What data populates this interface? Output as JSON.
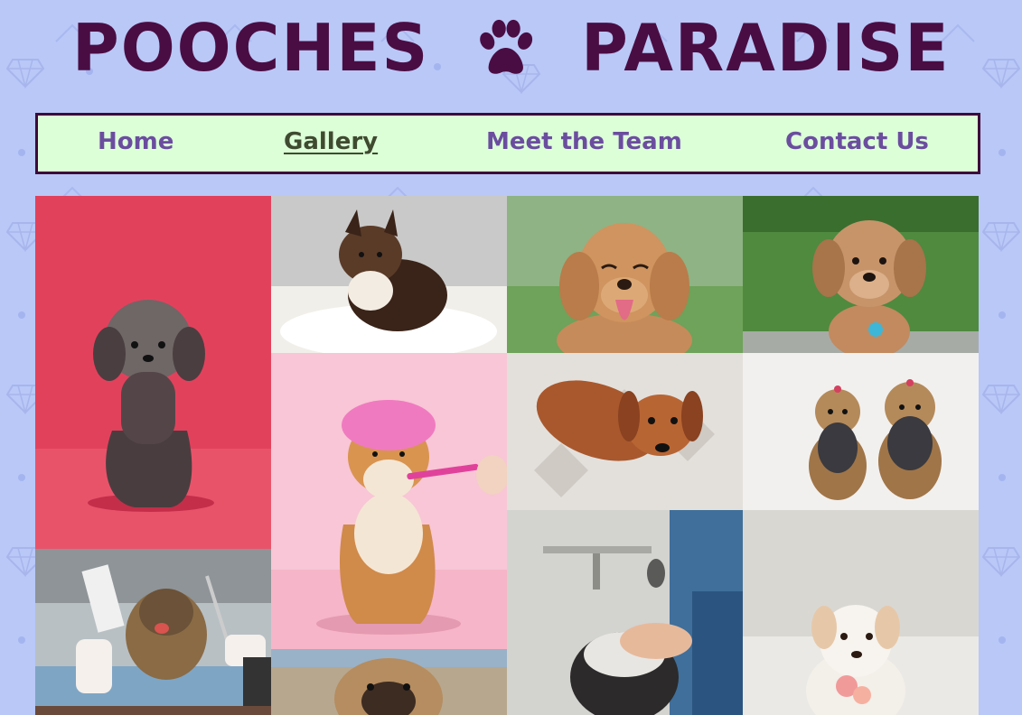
{
  "site": {
    "title_left": "POOCHES",
    "title_right": "PARADISE",
    "logo_icon": "paw-print-icon"
  },
  "nav": {
    "items": [
      {
        "label": "Home",
        "active": false
      },
      {
        "label": "Gallery",
        "active": true
      },
      {
        "label": "Meet the Team",
        "active": false
      },
      {
        "label": "Contact Us",
        "active": false
      }
    ]
  },
  "colors": {
    "page_bg": "#b9c8f7",
    "title": "#4a0d43",
    "nav_bg": "#dcffd8",
    "nav_border": "#3d0a38",
    "nav_link": "#6b4d9f",
    "nav_active": "#3f4a2f"
  },
  "gallery": {
    "photos": [
      {
        "subject": "poodle-mix-on-red-backdrop"
      },
      {
        "subject": "pomeranian-on-white-fur"
      },
      {
        "subject": "happy-golden-doodle-puppy"
      },
      {
        "subject": "cavapoo-on-grass"
      },
      {
        "subject": "shiba-inu-with-shower-cap-and-toothbrush"
      },
      {
        "subject": "dachshund-on-patterned-rug"
      },
      {
        "subject": "two-yorkshire-terriers"
      },
      {
        "subject": "yorkie-being-groomed-with-scissors"
      },
      {
        "subject": "dog-being-washed-in-shower"
      },
      {
        "subject": "white-dog-with-flower-collar"
      },
      {
        "subject": "pug-mix-outdoors"
      },
      {
        "subject": "partial-photo-bottom-left"
      }
    ]
  }
}
